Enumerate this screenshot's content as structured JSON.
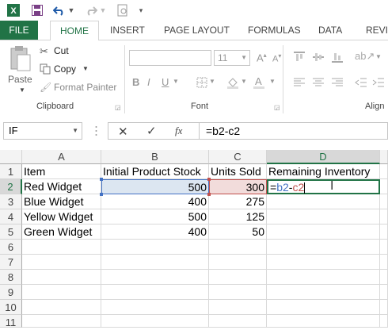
{
  "tabs": {
    "file": "FILE",
    "home": "HOME",
    "insert": "INSERT",
    "page_layout": "PAGE LAYOUT",
    "formulas": "FORMULAS",
    "data": "DATA",
    "review": "REVIE"
  },
  "ribbon": {
    "paste": "Paste",
    "cut": "Cut",
    "copy": "Copy",
    "format_painter": "Format Painter",
    "clipboard_group": "Clipboard",
    "font_size": "11",
    "font_group": "Font",
    "alignment_group": "Align"
  },
  "formula_bar": {
    "name_box": "IF",
    "fx": "fx",
    "formula": "=b2-c2"
  },
  "columns": [
    "A",
    "B",
    "C",
    "D"
  ],
  "rows": [
    "1",
    "2",
    "3",
    "4",
    "5",
    "6",
    "7",
    "8",
    "9",
    "10",
    "11"
  ],
  "cells": {
    "a1": "Item",
    "b1": "Initial Product Stock",
    "c1": "Units Sold",
    "d1": "Remaining Inventory",
    "a2": "Red Widget",
    "b2": "500",
    "c2": "300",
    "a3": "Blue Widget",
    "b3": "400",
    "c3": "275",
    "a4": "Yellow Widget",
    "b4": "500",
    "c4": "125",
    "a5": "Green Widget",
    "b5": "400",
    "c5": "50",
    "d2_eq": "=",
    "d2_ref1": "b2",
    "d2_minus": "-",
    "d2_ref2": "c2"
  },
  "colors": {
    "excel_green": "#217346",
    "ref_blue": "#4472c4",
    "ref_red": "#c0504d"
  }
}
